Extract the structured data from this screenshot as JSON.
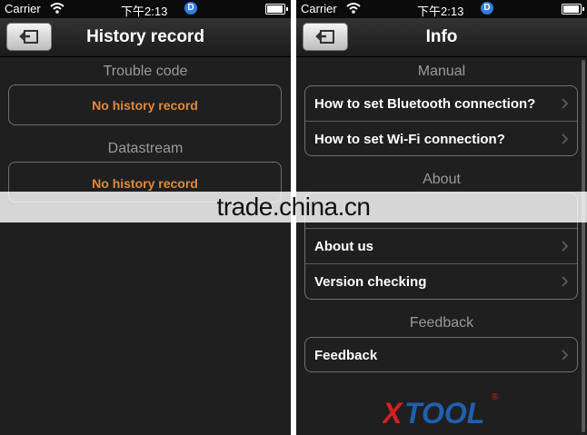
{
  "status": {
    "carrier": "Carrier",
    "time": "下午2:13",
    "badge": "D"
  },
  "left": {
    "title": "History record",
    "sections": [
      {
        "header": "Trouble code",
        "empty": "No history record"
      },
      {
        "header": "Datastream",
        "empty": "No history record"
      }
    ]
  },
  "right": {
    "title": "Info",
    "manual": {
      "header": "Manual",
      "items": [
        "How to set Bluetooth connection?",
        "How to set Wi-Fi connection?"
      ]
    },
    "about": {
      "header": "About",
      "items": [
        "",
        "About us",
        "Version checking"
      ]
    },
    "feedback": {
      "header": "Feedback",
      "items": [
        "Feedback"
      ]
    }
  },
  "logo": {
    "text": "XTOOL",
    "mark": "®"
  },
  "watermark": "trade.china.cn",
  "colors": {
    "accent_orange": "#e08a3c",
    "logo_red": "#d71f1f",
    "logo_blue": "#1f5fb0"
  }
}
